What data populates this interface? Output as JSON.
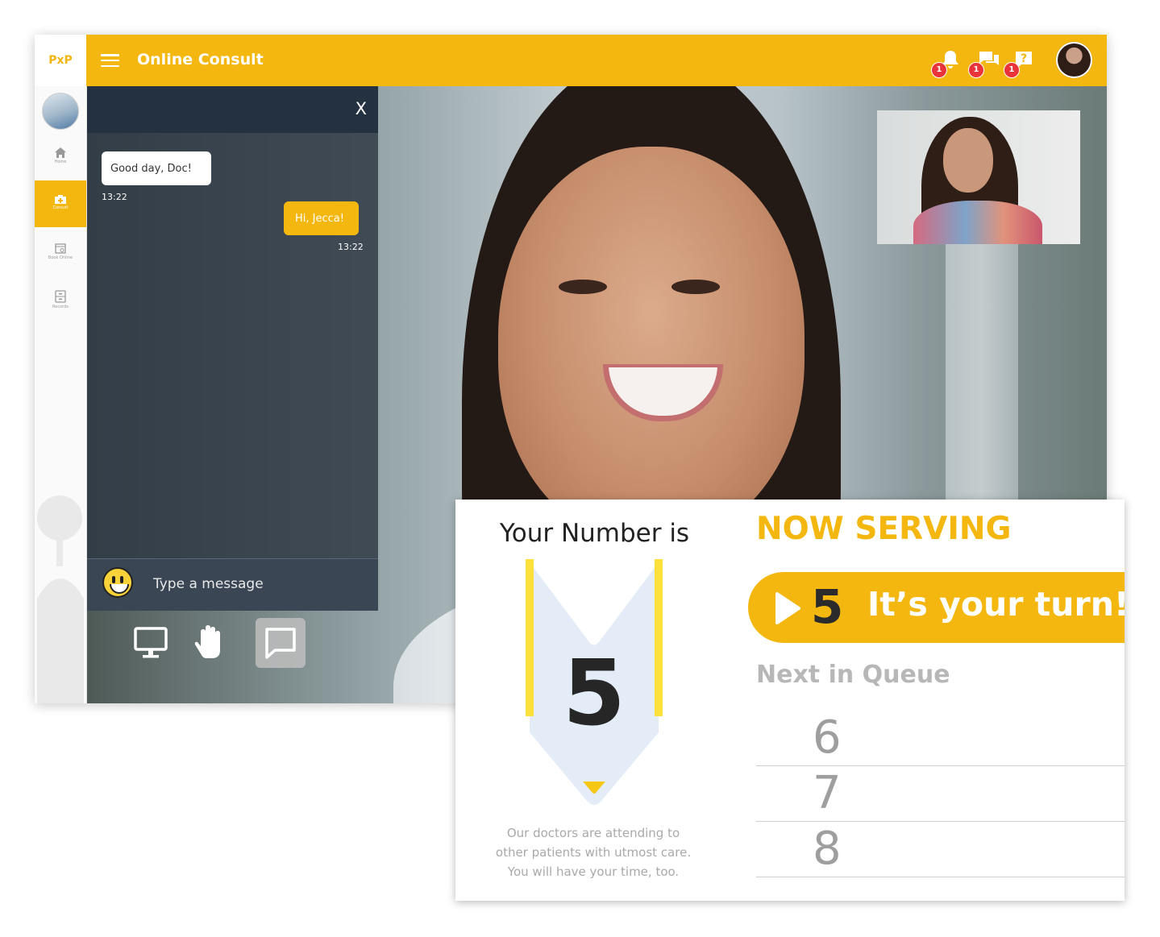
{
  "logo": {
    "text": "PxP"
  },
  "header": {
    "title": "Online Consult"
  },
  "notifications": [
    {
      "icon": "bell-icon",
      "count": "1"
    },
    {
      "icon": "chat-icon",
      "count": "1"
    },
    {
      "icon": "help-icon",
      "count": "1"
    }
  ],
  "sidebar": {
    "items": [
      {
        "label": "Home",
        "icon": "home-icon"
      },
      {
        "label": "Consult",
        "icon": "consult-icon",
        "active": true
      },
      {
        "label": "Book Online",
        "icon": "calendar-icon"
      },
      {
        "label": "Records",
        "icon": "records-icon"
      }
    ]
  },
  "chat": {
    "close_label": "X",
    "messages": [
      {
        "from": "patient",
        "text": "Good day, Doc!",
        "time": "13:22"
      },
      {
        "from": "self",
        "text": "Hi, Jecca!",
        "time": "13:22"
      }
    ],
    "input_placeholder": "Type a message"
  },
  "controls": [
    {
      "icon": "screen-share-icon"
    },
    {
      "icon": "raise-hand-icon"
    },
    {
      "icon": "chat-toggle-icon",
      "active": true
    }
  ],
  "queue": {
    "your_number_label": "Your Number is",
    "your_number": "5",
    "caption_lines": [
      "Our doctors are attending to",
      "other patients with utmost care.",
      "You will have your time, too."
    ],
    "now_serving_label": "NOW SERVING",
    "now_serving_number": "5",
    "now_serving_message": "It’s your turn!",
    "next_label": "Next in Queue",
    "next_numbers": [
      "6",
      "7",
      "8"
    ]
  },
  "colors": {
    "accent": "#f4b70f",
    "badge": "#e8333a",
    "chat_bg": "#2d3743"
  }
}
